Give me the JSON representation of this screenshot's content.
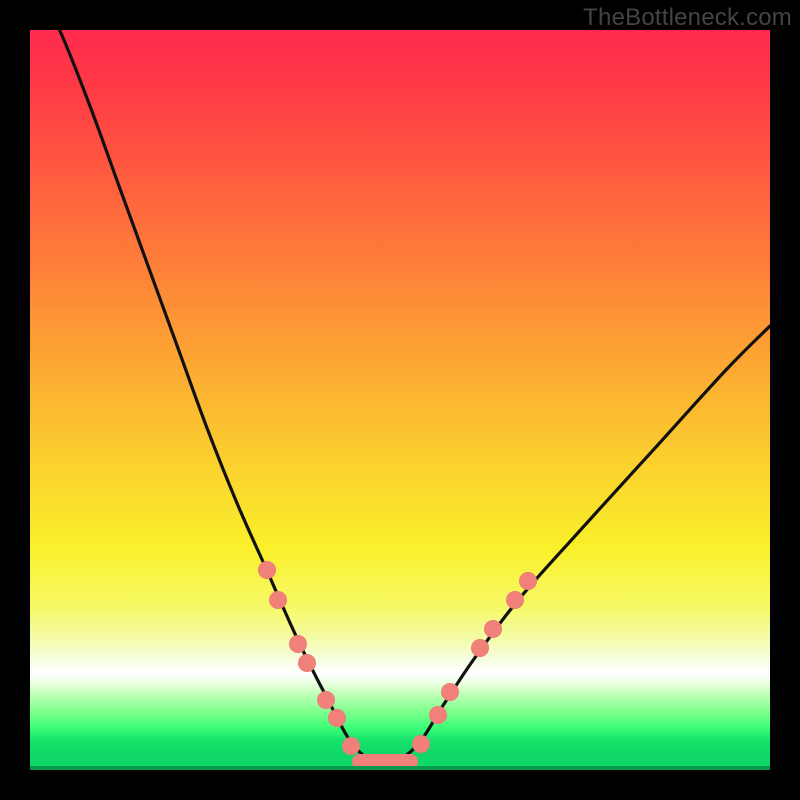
{
  "attribution": "TheBottleneck.com",
  "colors": {
    "frame": "#000000",
    "dot": "#f1807a",
    "curve": "#111111",
    "gradient_top": "#ff2a4d",
    "gradient_bottom": "#11db69"
  },
  "chart_data": {
    "type": "line",
    "title": "",
    "xlabel": "",
    "ylabel": "",
    "xlim": [
      0,
      100
    ],
    "ylim": [
      0,
      100
    ],
    "grid": false,
    "legend": false,
    "description": "V-shaped bottleneck curve. Y is bottleneck percentage (0 at bottom, 100 at top). X is relative component strength. Curve falls steeply from top-left, flattens near zero around x≈44–52, then rises to upper right. Pink dots mark sampled data points near the trough and a short pink horizontal bar marks the flat minimum.",
    "series": [
      {
        "name": "bottleneck-curve",
        "x": [
          0,
          4,
          8,
          12,
          16,
          20,
          24,
          28,
          32,
          36,
          40,
          44,
          48,
          52,
          56,
          60,
          66,
          74,
          84,
          94,
          100
        ],
        "y": [
          108,
          100,
          90,
          79,
          68,
          57,
          46,
          36,
          27,
          18,
          10,
          3,
          1,
          3,
          9,
          15,
          23,
          32,
          43,
          54,
          60
        ]
      }
    ],
    "markers": {
      "left_branch": [
        {
          "x": 32.0,
          "y": 27.0
        },
        {
          "x": 33.5,
          "y": 23.0
        },
        {
          "x": 36.2,
          "y": 17.0
        },
        {
          "x": 37.4,
          "y": 14.5
        },
        {
          "x": 40.0,
          "y": 9.5
        },
        {
          "x": 41.5,
          "y": 7.0
        },
        {
          "x": 43.4,
          "y": 3.2
        }
      ],
      "right_branch": [
        {
          "x": 52.8,
          "y": 3.5
        },
        {
          "x": 55.2,
          "y": 7.5
        },
        {
          "x": 56.8,
          "y": 10.5
        },
        {
          "x": 60.8,
          "y": 16.5
        },
        {
          "x": 62.5,
          "y": 19.0
        },
        {
          "x": 65.5,
          "y": 23.0
        },
        {
          "x": 67.3,
          "y": 25.5
        }
      ],
      "trough_bar": {
        "x_start": 43.5,
        "x_end": 52.5,
        "y": 1.2
      }
    }
  }
}
